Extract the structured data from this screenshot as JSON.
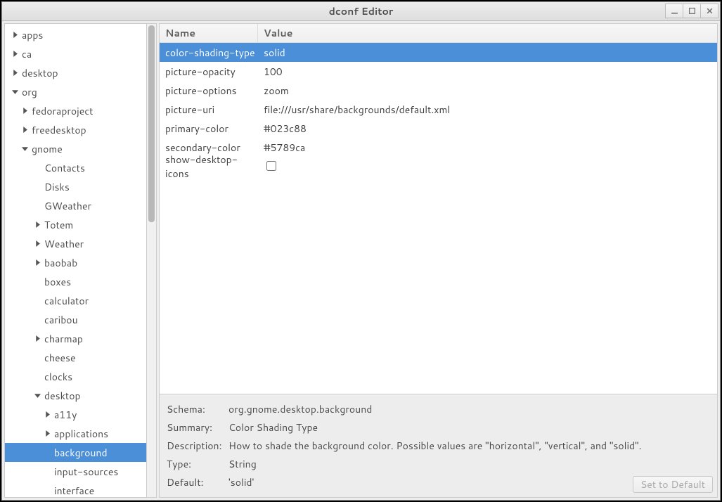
{
  "window": {
    "title": "dconf Editor"
  },
  "tree": [
    {
      "depth": 0,
      "label": "apps",
      "expander": "right"
    },
    {
      "depth": 0,
      "label": "ca",
      "expander": "right"
    },
    {
      "depth": 0,
      "label": "desktop",
      "expander": "right"
    },
    {
      "depth": 0,
      "label": "org",
      "expander": "down"
    },
    {
      "depth": 1,
      "label": "fedoraproject",
      "expander": "right"
    },
    {
      "depth": 1,
      "label": "freedesktop",
      "expander": "right"
    },
    {
      "depth": 1,
      "label": "gnome",
      "expander": "down"
    },
    {
      "depth": 2,
      "label": "Contacts",
      "expander": "none"
    },
    {
      "depth": 2,
      "label": "Disks",
      "expander": "none"
    },
    {
      "depth": 2,
      "label": "GWeather",
      "expander": "none"
    },
    {
      "depth": 2,
      "label": "Totem",
      "expander": "right"
    },
    {
      "depth": 2,
      "label": "Weather",
      "expander": "right"
    },
    {
      "depth": 2,
      "label": "baobab",
      "expander": "right"
    },
    {
      "depth": 2,
      "label": "boxes",
      "expander": "none"
    },
    {
      "depth": 2,
      "label": "calculator",
      "expander": "none"
    },
    {
      "depth": 2,
      "label": "caribou",
      "expander": "none"
    },
    {
      "depth": 2,
      "label": "charmap",
      "expander": "right"
    },
    {
      "depth": 2,
      "label": "cheese",
      "expander": "none"
    },
    {
      "depth": 2,
      "label": "clocks",
      "expander": "none"
    },
    {
      "depth": 2,
      "label": "desktop",
      "expander": "down"
    },
    {
      "depth": 3,
      "label": "a11y",
      "expander": "right"
    },
    {
      "depth": 3,
      "label": "applications",
      "expander": "right"
    },
    {
      "depth": 3,
      "label": "background",
      "expander": "none",
      "selected": true
    },
    {
      "depth": 3,
      "label": "input-sources",
      "expander": "none"
    },
    {
      "depth": 3,
      "label": "interface",
      "expander": "none"
    }
  ],
  "table": {
    "headers": {
      "name": "Name",
      "value": "Value"
    },
    "rows": [
      {
        "name": "color-shading-type",
        "value": "solid",
        "type": "text",
        "selected": true
      },
      {
        "name": "picture-opacity",
        "value": "100",
        "type": "text"
      },
      {
        "name": "picture-options",
        "value": "zoom",
        "type": "text"
      },
      {
        "name": "picture-uri",
        "value": "file:///usr/share/backgrounds/default.xml",
        "type": "text"
      },
      {
        "name": "primary-color",
        "value": "#023c88",
        "type": "text"
      },
      {
        "name": "secondary-color",
        "value": "#5789ca",
        "type": "text"
      },
      {
        "name": "show-desktop-icons",
        "value": "false",
        "type": "checkbox"
      }
    ]
  },
  "detail": {
    "labels": {
      "schema": "Schema:",
      "summary": "Summary:",
      "description": "Description:",
      "type": "Type:",
      "default": "Default:"
    },
    "schema": "org.gnome.desktop.background",
    "summary": "Color Shading Type",
    "description": "How to shade the background color. Possible values are \"horizontal\", \"vertical\", and \"solid\".",
    "type": "String",
    "default": "'solid'",
    "reset_button": "Set to Default"
  }
}
